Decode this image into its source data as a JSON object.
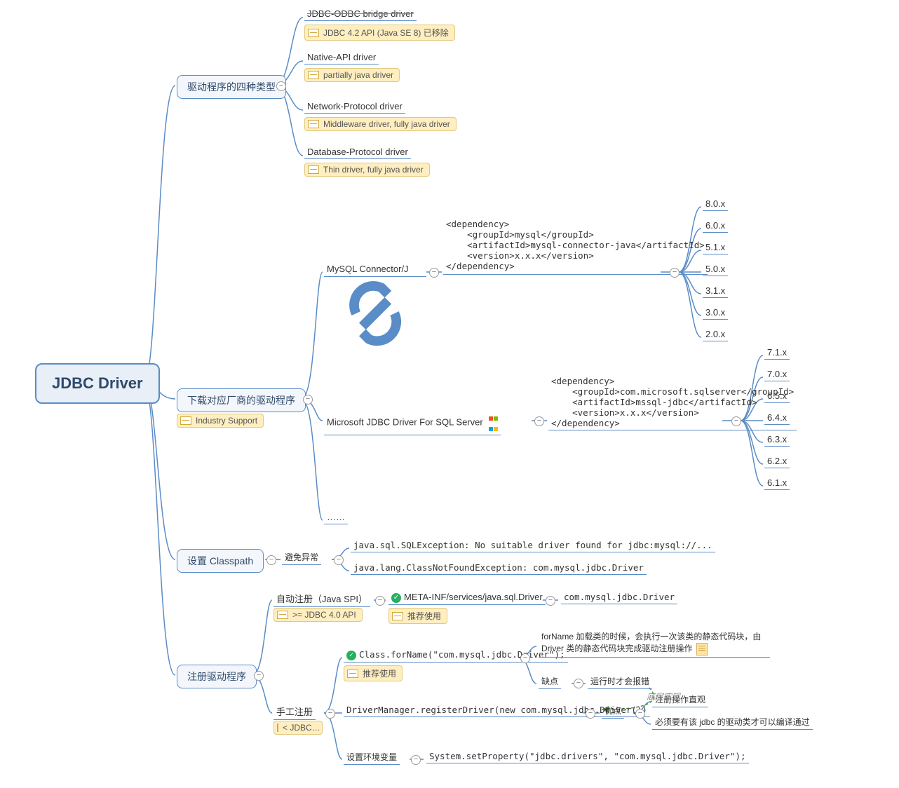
{
  "root": "JDBC Driver",
  "branch1": {
    "label": "驱动程序的四种类型",
    "items": [
      {
        "title": "JDBC-ODBC bridge driver",
        "strike": true,
        "note": "JDBC 4.2 API (Java SE 8) 已移除"
      },
      {
        "title": "Native-API driver",
        "note": "partially java driver"
      },
      {
        "title": "Network-Protocol driver",
        "note": "Middleware driver, fully java driver"
      },
      {
        "title": "Database-Protocol driver",
        "note": "Thin driver, fully java driver"
      }
    ]
  },
  "branch2": {
    "label": "下载对应厂商的驱动程序",
    "note": "Industry Support",
    "items": {
      "mysql": {
        "label": "MySQL Connector/J",
        "dep": "<dependency>\n    <groupId>mysql</groupId>\n    <artifactId>mysql-connector-java</artifactId>\n    <version>x.x.x</version>\n</dependency>",
        "versions": [
          "8.0.x",
          "6.0.x",
          "5.1.x",
          "5.0.x",
          "3.1.x",
          "3.0.x",
          "2.0.x"
        ]
      },
      "mssql": {
        "label": "Microsoft JDBC Driver For SQL Server",
        "dep": "<dependency>\n    <groupId>com.microsoft.sqlserver</groupId>\n    <artifactId>mssql-jdbc</artifactId>\n    <version>x.x.x</version>\n</dependency>",
        "versions": [
          "7.1.x",
          "7.0.x",
          "6.5.x",
          "6.4.x",
          "6.3.x",
          "6.2.x",
          "6.1.x"
        ]
      },
      "more": "……"
    }
  },
  "branch3": {
    "label": "设置 Classpath",
    "sub": "避免异常",
    "errors": [
      "java.sql.SQLException: No suitable driver found for jdbc:mysql://...",
      "java.lang.ClassNotFoundException: com.mysql.jdbc.Driver"
    ]
  },
  "branch4": {
    "label": "注册驱动程序",
    "auto": {
      "label": "自动注册（Java SPI）",
      "note": ">= JDBC 4.0 API",
      "spi": "META-INF/services/java.sql.Driver",
      "spi_note": "推荐使用",
      "spi_val": "com.mysql.jdbc.Driver"
    },
    "manual": {
      "label": "手工注册",
      "note": "< JDBC…",
      "forname": {
        "code": "Class.forName(\"com.mysql.jdbc.Driver\");",
        "note": "推荐使用",
        "desc": "forName 加载类的时候，会执行一次该类的静态代码块，由 Driver 类的静态代码块完成驱动注册操作",
        "con": "缺点",
        "con_val": "运行时才会报错"
      },
      "register": {
        "code": "DriverManager.registerDriver(new com.mysql.jdbc.Driver())",
        "pros_label": "优点",
        "pros": [
          "注册操作直观",
          "必须要有该 jdbc 的驱动类才可以编译通过"
        ]
      },
      "env": {
        "label": "设置环境变量",
        "code": "System.setProperty(\"jdbc.drivers\", \"com.mysql.jdbc.Driver\");"
      },
      "rel_annot": "底层实现"
    }
  }
}
